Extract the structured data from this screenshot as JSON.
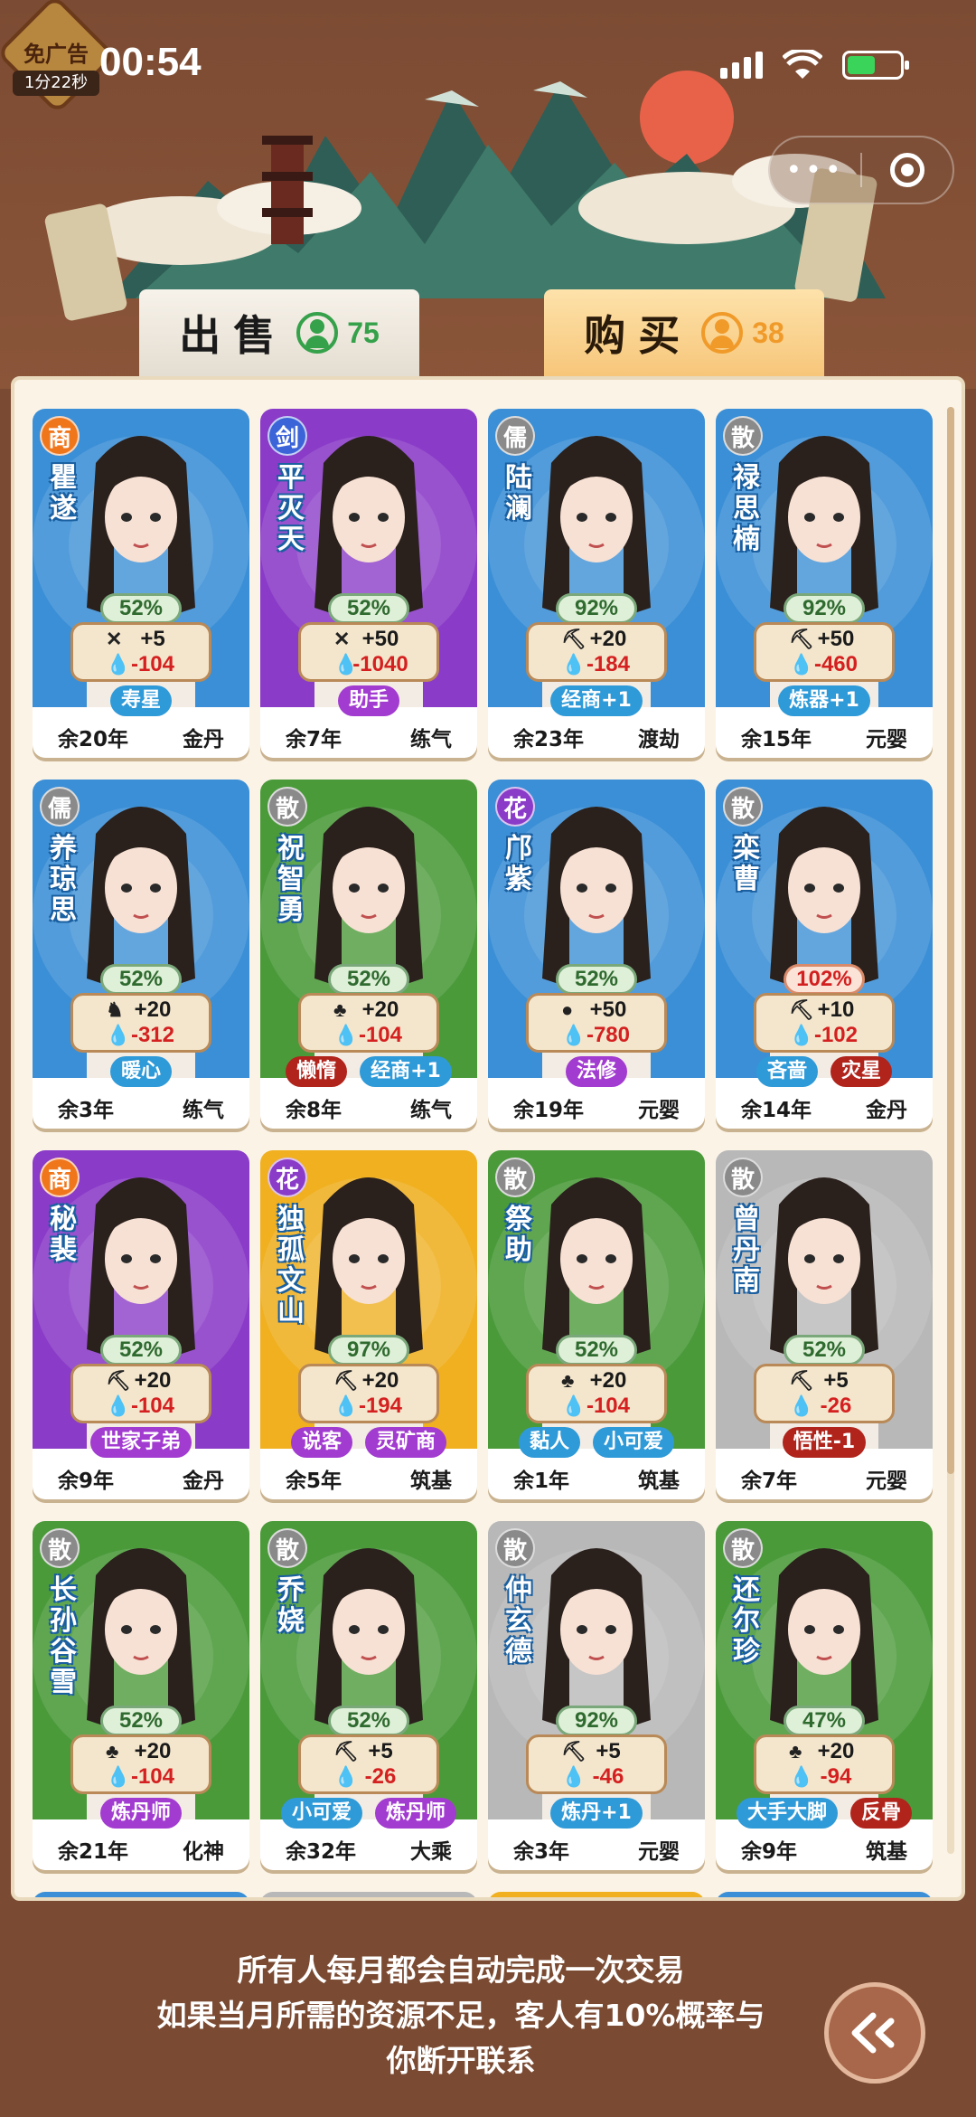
{
  "status_bar": {
    "ad_badge_label": "免广告",
    "ad_timer": "1分22秒",
    "time": "00:54"
  },
  "tabs": [
    {
      "label": "出售",
      "count": "75",
      "active": false
    },
    {
      "label": "购买",
      "count": "38",
      "active": true
    }
  ],
  "cards": [
    {
      "sect": "商",
      "sect_color": "#f0761c",
      "name": "瞿遂",
      "bg": "#3b8fd6",
      "pct": "52%",
      "pct_warn": false,
      "gain_icon": "moth-icon",
      "gain": "+5",
      "cost": "-104",
      "tags": [
        {
          "text": "寿星",
          "color": "blue"
        }
      ],
      "years": "余20年",
      "realm": "金丹"
    },
    {
      "sect": "剑",
      "sect_color": "#3b64d8",
      "name": "平灭天",
      "bg": "#8a3bc8",
      "pct": "52%",
      "pct_warn": false,
      "gain_icon": "moth-icon",
      "gain": "+50",
      "cost": "-1040",
      "tags": [
        {
          "text": "助手",
          "color": "purple"
        }
      ],
      "years": "余7年",
      "realm": "练气"
    },
    {
      "sect": "儒",
      "sect_color": "#8a8a8a",
      "name": "陆澜",
      "bg": "#3b8fd6",
      "pct": "92%",
      "pct_warn": false,
      "gain_icon": "pickaxe-icon",
      "gain": "+20",
      "cost": "-184",
      "tags": [
        {
          "text": "经商+1",
          "color": "blue"
        }
      ],
      "years": "余23年",
      "realm": "渡劫"
    },
    {
      "sect": "散",
      "sect_color": "#8a8a8a",
      "name": "禄思楠",
      "bg": "#3b8fd6",
      "pct": "92%",
      "pct_warn": false,
      "gain_icon": "pickaxe-icon",
      "gain": "+50",
      "cost": "-460",
      "tags": [
        {
          "text": "炼器+1",
          "color": "blue"
        }
      ],
      "years": "余15年",
      "realm": "元婴"
    },
    {
      "sect": "儒",
      "sect_color": "#8a8a8a",
      "name": "养琼思",
      "bg": "#3b8fd6",
      "pct": "52%",
      "pct_warn": false,
      "gain_icon": "beast-icon",
      "gain": "+20",
      "cost": "-312",
      "tags": [
        {
          "text": "暖心",
          "color": "blue"
        }
      ],
      "years": "余3年",
      "realm": "练气"
    },
    {
      "sect": "散",
      "sect_color": "#8a8a8a",
      "name": "祝智勇",
      "bg": "#4a9a3a",
      "pct": "52%",
      "pct_warn": false,
      "gain_icon": "herb-icon",
      "gain": "+20",
      "cost": "-104",
      "tags": [
        {
          "text": "懒惰",
          "color": "red"
        },
        {
          "text": "经商+1",
          "color": "blue"
        }
      ],
      "years": "余8年",
      "realm": "练气"
    },
    {
      "sect": "花",
      "sect_color": "#8a3bc8",
      "name": "邝紫",
      "bg": "#3b8fd6",
      "pct": "52%",
      "pct_warn": false,
      "gain_icon": "cauldron-icon",
      "gain": "+50",
      "cost": "-780",
      "tags": [
        {
          "text": "法修",
          "color": "purple"
        }
      ],
      "years": "余19年",
      "realm": "元婴"
    },
    {
      "sect": "散",
      "sect_color": "#8a8a8a",
      "name": "栾曹",
      "bg": "#3b8fd6",
      "pct": "102%",
      "pct_warn": true,
      "gain_icon": "pickaxe-icon",
      "gain": "+10",
      "cost": "-102",
      "tags": [
        {
          "text": "吝啬",
          "color": "blue"
        },
        {
          "text": "灾星",
          "color": "red"
        }
      ],
      "years": "余14年",
      "realm": "金丹"
    },
    {
      "sect": "商",
      "sect_color": "#f0761c",
      "name": "秘裴",
      "bg": "#8a3bc8",
      "pct": "52%",
      "pct_warn": false,
      "gain_icon": "pickaxe-icon",
      "gain": "+20",
      "cost": "-104",
      "tags": [
        {
          "text": "世家子弟",
          "color": "purple"
        }
      ],
      "years": "余9年",
      "realm": "金丹"
    },
    {
      "sect": "花",
      "sect_color": "#8a3bc8",
      "name": "独孤文山",
      "bg": "#f0b020",
      "pct": "97%",
      "pct_warn": false,
      "gain_icon": "pickaxe-icon",
      "gain": "+20",
      "cost": "-194",
      "tags": [
        {
          "text": "说客",
          "color": "purple"
        },
        {
          "text": "灵矿商",
          "color": "purple"
        }
      ],
      "years": "余5年",
      "realm": "筑基"
    },
    {
      "sect": "散",
      "sect_color": "#8a8a8a",
      "name": "祭助",
      "bg": "#4a9a3a",
      "pct": "52%",
      "pct_warn": false,
      "gain_icon": "herb-icon",
      "gain": "+20",
      "cost": "-104",
      "tags": [
        {
          "text": "黏人",
          "color": "blue"
        },
        {
          "text": "小可爱",
          "color": "blue"
        }
      ],
      "years": "余1年",
      "realm": "筑基"
    },
    {
      "sect": "散",
      "sect_color": "#8a8a8a",
      "name": "曾丹南",
      "bg": "#b8b8b8",
      "pct": "52%",
      "pct_warn": false,
      "gain_icon": "pickaxe-icon",
      "gain": "+5",
      "cost": "-26",
      "tags": [
        {
          "text": "悟性-1",
          "color": "red"
        }
      ],
      "years": "余7年",
      "realm": "元婴"
    },
    {
      "sect": "散",
      "sect_color": "#8a8a8a",
      "name": "长孙谷雪",
      "bg": "#4a9a3a",
      "pct": "52%",
      "pct_warn": false,
      "gain_icon": "herb-icon",
      "gain": "+20",
      "cost": "-104",
      "tags": [
        {
          "text": "炼丹师",
          "color": "purple"
        }
      ],
      "years": "余21年",
      "realm": "化神"
    },
    {
      "sect": "散",
      "sect_color": "#8a8a8a",
      "name": "乔娆",
      "bg": "#4a9a3a",
      "pct": "52%",
      "pct_warn": false,
      "gain_icon": "pickaxe-icon",
      "gain": "+5",
      "cost": "-26",
      "tags": [
        {
          "text": "小可爱",
          "color": "blue"
        },
        {
          "text": "炼丹师",
          "color": "purple"
        }
      ],
      "years": "余32年",
      "realm": "大乘"
    },
    {
      "sect": "散",
      "sect_color": "#8a8a8a",
      "name": "仲玄德",
      "bg": "#b8b8b8",
      "pct": "92%",
      "pct_warn": false,
      "gain_icon": "pickaxe-icon",
      "gain": "+5",
      "cost": "-46",
      "tags": [
        {
          "text": "炼丹+1",
          "color": "blue"
        }
      ],
      "years": "余3年",
      "realm": "元婴"
    },
    {
      "sect": "散",
      "sect_color": "#8a8a8a",
      "name": "还尔珍",
      "bg": "#4a9a3a",
      "pct": "47%",
      "pct_warn": false,
      "gain_icon": "herb-icon",
      "gain": "+20",
      "cost": "-94",
      "tags": [
        {
          "text": "大手大脚",
          "color": "blue"
        },
        {
          "text": "反骨",
          "color": "red"
        }
      ],
      "years": "余9年",
      "realm": "筑基"
    }
  ],
  "info": {
    "line1": "所有人每月都会自动完成一次交易",
    "line2": "如果当月所需的资源不足，客人有10%概率与",
    "line3": "你断开联系"
  }
}
